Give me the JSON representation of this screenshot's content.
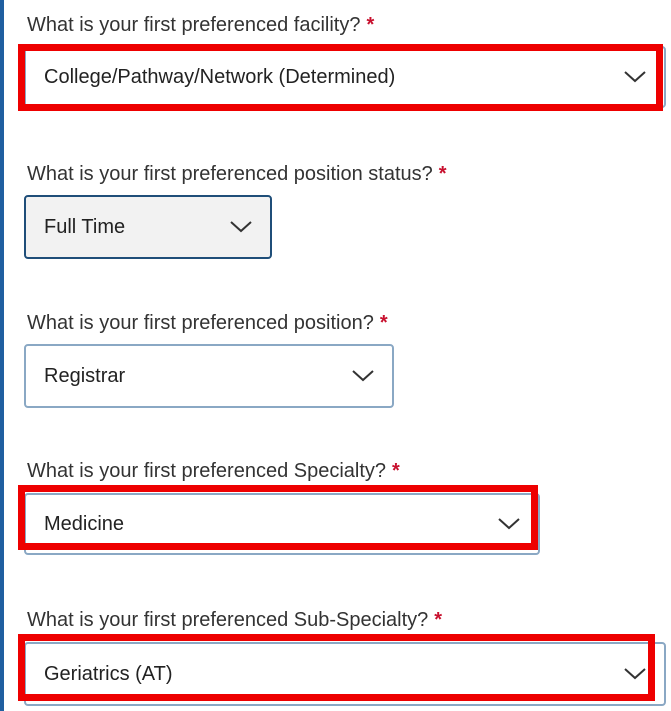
{
  "required_marker": "*",
  "fields": [
    {
      "question": "What is your first preferenced facility?",
      "value": "College/Pathway/Network (Determined)"
    },
    {
      "question": "What is your first preferenced position status?",
      "value": "Full Time"
    },
    {
      "question": "What is your first preferenced position?",
      "value": "Registrar"
    },
    {
      "question": "What is your first preferenced Specialty?",
      "value": "Medicine"
    },
    {
      "question": "What is your first preferenced Sub-Specialty?",
      "value": "Geriatrics (AT)"
    }
  ],
  "colors": {
    "highlight": "#ee0000",
    "required": "#c8102e",
    "focused_border": "#1f4e79"
  }
}
